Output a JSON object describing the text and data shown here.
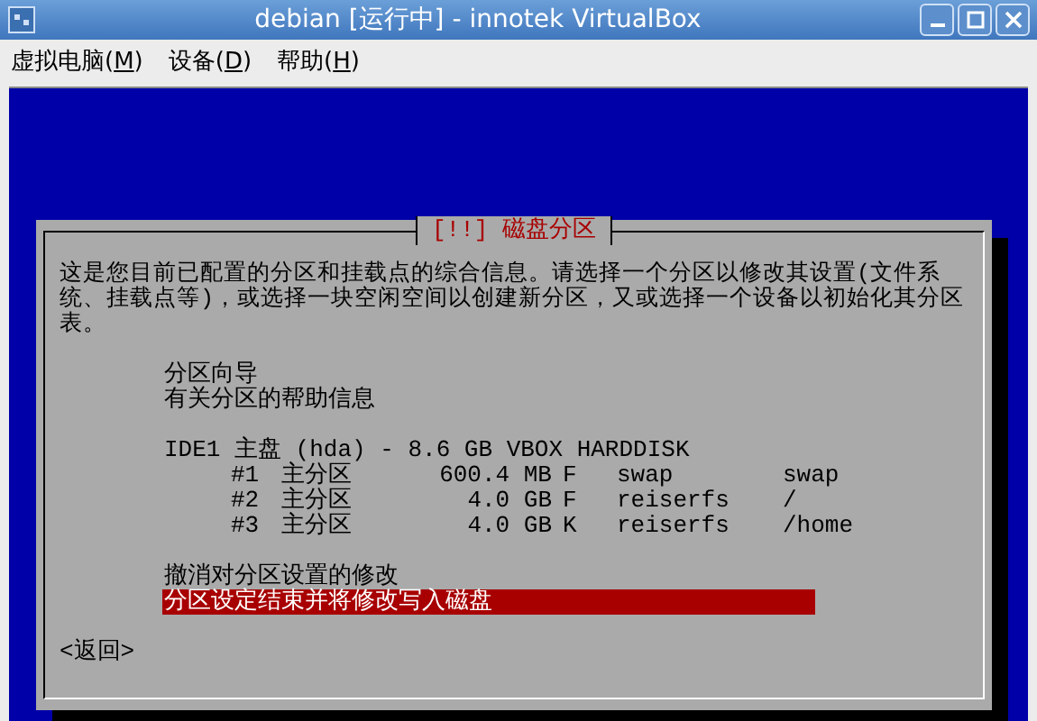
{
  "window": {
    "title": "debian [运行中] - innotek VirtualBox"
  },
  "menu": [
    {
      "text": "虚拟电脑(",
      "access_key": "M",
      "text_end": ")"
    },
    {
      "text": "设备(",
      "access_key": "D",
      "text_end": ")"
    },
    {
      "text": "帮助(",
      "access_key": "H",
      "text_end": ")"
    }
  ],
  "dialog": {
    "title": "[!!] 磁盘分区",
    "description": "这是您目前已配置的分区和挂载点的综合信息。请选择一个分区以修改其设置(文件系统、挂载点等)，或选择一块空闲空间以创建新分区，又或选择一个设备以初始化其分区表。",
    "items": [
      {
        "entries": [
          {
            "kind": "option",
            "label": "分区向导",
            "selected": false
          },
          {
            "kind": "option",
            "label": "有关分区的帮助信息",
            "selected": false
          }
        ]
      },
      {
        "entries": [
          {
            "kind": "disk",
            "label": "IDE1 主盘 (hda) - 8.6 GB VBOX HARDDISK",
            "selected": false
          },
          {
            "kind": "partition",
            "number": "#1",
            "type": "主分区",
            "size": "600.4 MB",
            "flag": "F",
            "fs": "swap",
            "mount": "swap",
            "selected": false
          },
          {
            "kind": "partition",
            "number": "#2",
            "type": "主分区",
            "size": "4.0 GB",
            "flag": "F",
            "fs": "reiserfs",
            "mount": "/",
            "selected": false
          },
          {
            "kind": "partition",
            "number": "#3",
            "type": "主分区",
            "size": "4.0 GB",
            "flag": "K",
            "fs": "reiserfs",
            "mount": "/home",
            "selected": false
          }
        ]
      },
      {
        "entries": [
          {
            "kind": "option",
            "label": "撤消对分区设置的修改",
            "selected": false
          },
          {
            "kind": "option",
            "label": "分区设定结束并将修改写入磁盘",
            "selected": true
          }
        ]
      }
    ],
    "back_button": "<返回>"
  }
}
